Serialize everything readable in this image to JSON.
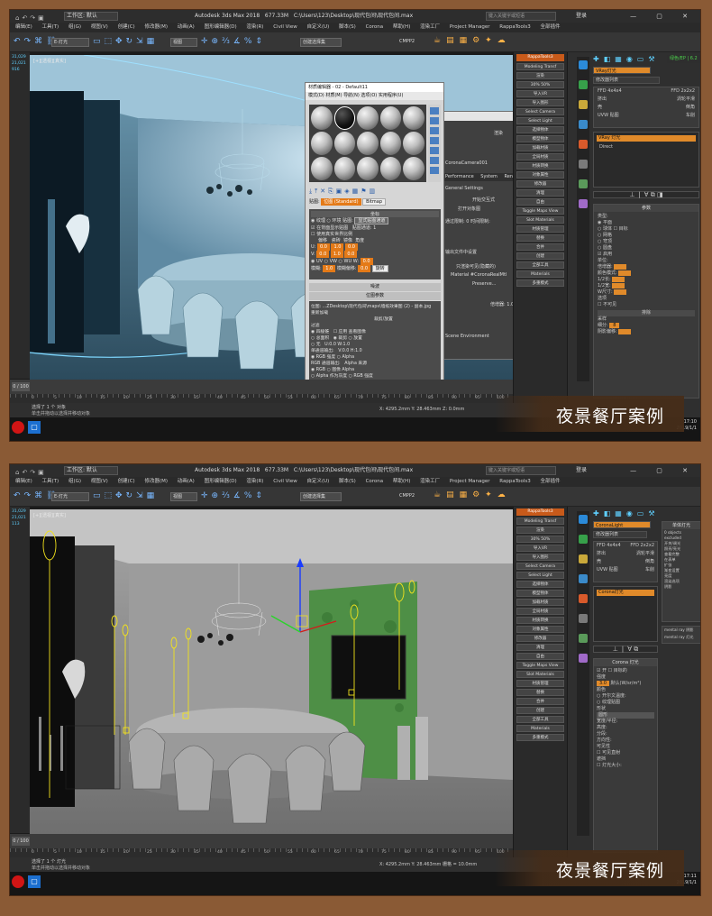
{
  "app": {
    "title": "Autodesk 3ds Max 2018",
    "memory": "677.33M",
    "file_path": "C:\\Users\\123\\Desktop\\现代包间\\现代包间.max",
    "workspace": "工作区: 默认",
    "search_placeholder": "键入关键字或短语",
    "login": "登录",
    "window_controls": "— ▢ ✕"
  },
  "menu": [
    "编辑(E)",
    "工具(T)",
    "组(G)",
    "视图(V)",
    "创建(C)",
    "修改器(M)",
    "动画(A)",
    "图形编辑器(D)",
    "渲染(R)",
    "Civil View",
    "自定义(U)",
    "脚本(S)",
    "Corona",
    "帮助(H)",
    "渲染工厂",
    "Project Manager",
    "RappaTools3",
    "全部插件"
  ],
  "toolbar": {
    "selection_filter": "全部",
    "view_dropdown": "视图",
    "named_selection": "创建选择集",
    "second_dropdown": "E-灯光",
    "viewport_text_1": "",
    "cmd_pack": "CMPP2"
  },
  "viewport": {
    "label": "[+][透视][真实]",
    "stats": [
      "31,029",
      "21,021",
      "916"
    ],
    "stats2": [
      "31,029",
      "21,021",
      "113"
    ]
  },
  "timeline": {
    "ticks": [
      "0",
      "5",
      "10",
      "15",
      "20",
      "25",
      "30",
      "35",
      "40",
      "45",
      "50",
      "55",
      "60",
      "65",
      "70",
      "75",
      "80",
      "85",
      "90",
      "95",
      "100"
    ],
    "frame": "0 / 100"
  },
  "status": {
    "selection_1": "选择了 1 个 对象",
    "selection_2": "选择了 1 个 灯光",
    "hint": "单击并拖动以选择并移动对象",
    "coord_x": "X: 4295.2mm",
    "coord_y": "Y: 28.463mm",
    "coord_z": "Z: 0.0mm",
    "grid": "栅格 = 10.0mm",
    "add_time_tag": "添加时间标记",
    "auto_key": "自动关键点",
    "selected_obj": "选定对象",
    "set_key": "设置关键点",
    "key_filters": "关键点过滤器..."
  },
  "clock": {
    "time_1": "17:10",
    "date_1": "2019/1/1",
    "time_2": "17:11",
    "date_2": "2019/1/1"
  },
  "banner": {
    "text_1": "夜景餐厅案例",
    "text_2": "夜景餐厅案例"
  },
  "plugin_panel": {
    "title": "RappaTools3",
    "tabs": [
      "Modeling",
      "Transf"
    ],
    "buttons": [
      "渲染",
      "30%",
      "50%",
      "导入VR",
      "导入图形",
      "Select Camera",
      "Select Light",
      "选择物体",
      "模型物体",
      "加载材质",
      "全局材质",
      "材质转换",
      "对象属性",
      "修改器",
      "清理",
      "自由",
      "Toggle Maps View",
      "Slot Materials",
      "材质管理",
      "替换"
    ],
    "merge_btn": "合并",
    "create_btn": "创建",
    "tools_row": "全部工具",
    "material_btn": "Materials",
    "mode_btn": "多重模式"
  },
  "command_panel": {
    "object_name": "VRay灯光",
    "modifier_list": "修改器列表",
    "ffd_a": "FFD 4x4x4",
    "ffd_b": "FFD 2x2x2",
    "extrude": "挤出",
    "lathe": "车削",
    "shell": "壳",
    "uvw": "UVW 贴图",
    "turbo": "涡轮平滑",
    "bevel": "倒角",
    "stack_item_1": "VRay 灯光",
    "stack_item_2": "Corona灯光",
    "stack_sub_1": "Direct",
    "stack_sub_2": "CoronaLight",
    "params_title": "参数",
    "type_label": "类型:",
    "types": [
      "平面",
      "球体",
      "网格",
      "穹顶",
      "圆盘"
    ],
    "type_extra": [
      "目标",
      "启用"
    ],
    "units": "单位:",
    "multiplier": "倍增器:",
    "color_mode": "颜色模式:",
    "size_x": "1/2长:",
    "size_y": "1/2宽:",
    "size_w": "W尺寸:",
    "options": "选项",
    "invisible": "不可见",
    "excl_btn": "排除",
    "sampling": "采样",
    "subdivs": "细分:",
    "subdivs_val": "8",
    "shadow_bias": "阴影偏移:",
    "green_btn": "绿色/EP | 6.2",
    "right_list_title": "单体灯光",
    "right_items": [
      "0 objects excluded",
      "开关/调光",
      "照亮/亮光",
      "查看完整",
      "在表单",
      "扩张",
      "渐变设置",
      "亮度",
      "渲染选项",
      "阴影"
    ],
    "corona_light_title": "Corona 灯光",
    "corona_on": "开",
    "corona_targeted": "目标的",
    "corona_intensity_label": "强度",
    "corona_intensity": "3.0",
    "corona_units": "默认(W/sr/m²)",
    "corona_color": "颜色",
    "corona_kelvin": "开尔文温度:",
    "corona_texmap": "纹理贴图",
    "corona_shape": "形状",
    "corona_shape_val": "圆形",
    "corona_width": "宽度/半径:",
    "corona_height": "高度:",
    "corona_segments": "分段:",
    "corona_directionality": "方向性:",
    "corona_visibility": "可见性",
    "corona_vis_direct": "可见直射",
    "corona_occluder": "遮挡",
    "corona_light_size": "灯光大小:",
    "vray_ray_1": "mental ray 阴影",
    "vray_ray_2": "mental ray 灯光"
  },
  "material_editor": {
    "title": "材质编辑器 - 02 - Default11",
    "menu": [
      "模式(D)",
      "材质(M)",
      "导航(N)",
      "选项(O)",
      "实用程序(U)"
    ],
    "map_label": "贴图:",
    "map_field": "位图 (Standard)",
    "map_type": "Bitmap",
    "coords_title": "坐标",
    "tex_label": "纹理",
    "env_label": "环境",
    "mapping_label": "贴图:",
    "mapping_val": "显式贴图通道",
    "show_map_back": "在背面显示贴图",
    "map_channel": "贴图通道:",
    "map_channel_val": "1",
    "use_real_world": "使用真实世界比例",
    "offset": "偏移",
    "tiling": "瓷砖",
    "mirror": "镜像",
    "angle": "角度",
    "u_val": "0.0",
    "v_val": "0.0",
    "tile_u": "1.0",
    "tile_v": "1.0",
    "angle_u": "0.0",
    "angle_v": "0.0",
    "angle_w": "0.0",
    "uv_opts": [
      "UV",
      "VW",
      "WU"
    ],
    "blur": "模糊:",
    "blur_val": "1.0",
    "blur_offset": "模糊偏移:",
    "blur_offset_val": "0.0",
    "rotate_btn": "旋转",
    "noise_title": "噪波",
    "bitmap_params": "位图参数",
    "bitmap_path": "位图: ...ZDesktop\\现代包间\\maps\\墙纸效果图 (2) - 副本.jpg",
    "reload_btn": "重新加载",
    "crop_title": "裁剪/放置",
    "filter_title": "过滤",
    "filters": [
      "四棱锥",
      "总面积",
      "无"
    ],
    "apply_btn": "应用",
    "view_image_btn": "查看图像",
    "crop_opt": "裁剪",
    "place_opt": "放置",
    "mono_title": "单通道输出:",
    "mono_opts": [
      "RGB 强度",
      "Alpha"
    ],
    "rgb_title": "RGB 通道输出:",
    "rgb_opts": [
      "RGB",
      "Alpha 作为灰度"
    ],
    "alpha_title": "Alpha 来源",
    "alpha_opts": [
      "图像 Alpha",
      "RGB 强度",
      "无(不透明)"
    ],
    "u_label": "U:",
    "v_label": "V:",
    "w_label": "W:",
    "h_label": "H:",
    "crop_u": "0.0",
    "crop_v": "0.0",
    "crop_w": "1.0",
    "crop_h": "1.0",
    "premult": "预乘 Alpha"
  },
  "render_dialog": {
    "title_btns": "— ▢ ✕",
    "render_btn": "渲染",
    "camera": "CoronaCamera001",
    "tabs": [
      "Performance",
      "System",
      "Render Elements"
    ],
    "general": "General Settings",
    "start_ir": "开始交互式",
    "render_active": "打开对象图",
    "pass_limit": "通过限制:",
    "time_limit": "时间限制:",
    "h": "时",
    "m": "分",
    "s": "秒",
    "dest": "输出文件中设置",
    "save_to": "保存上次渲染",
    "material_override": "只渲染可见(隐藏的)",
    "override_mat": "Material #CoronaRealMtl",
    "preserve": "Preserve...",
    "environment": "Scene Environment",
    "multiplier": "倍增器:",
    "pass_val": "0",
    "time_h": "0",
    "time_m": "0",
    "time_s": "0",
    "mult_val": "1.0"
  },
  "icons": {
    "undo": "undo-icon",
    "redo": "redo-icon",
    "select": "select-icon",
    "move": "move-icon",
    "rotate": "rotate-icon",
    "scale": "scale-icon",
    "snap": "snap-icon",
    "render": "render-teapot-icon"
  },
  "colors": {
    "accent_orange": "#e08a2a",
    "selection_blue": "#5fd0ff",
    "green_wall": "#4e8f46",
    "light_yellow": "#f2e21c"
  }
}
